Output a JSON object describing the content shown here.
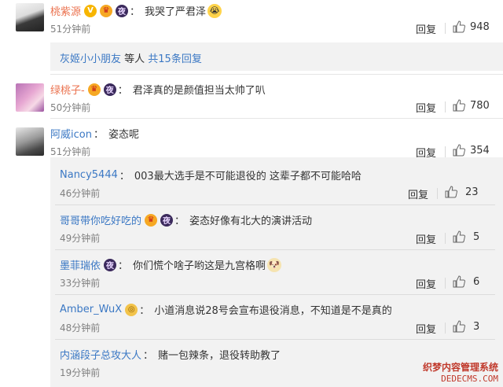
{
  "comments": [
    {
      "user": "桃紫源",
      "text": "我哭了严君泽",
      "time": "51分钟前",
      "reply": "回复",
      "likes": "948",
      "more": {
        "names": "灰姬小小朋友",
        "mid": " 等人 ",
        "count": "共15条回复"
      }
    },
    {
      "user": "绿桃子-",
      "text": "君泽真的是颜值担当太帅了叭",
      "time": "50分钟前",
      "reply": "回复",
      "likes": "780"
    },
    {
      "user": "阿威icon",
      "text": "姿态呢",
      "time": "51分钟前",
      "reply": "回复",
      "likes": "354"
    }
  ],
  "replies": [
    {
      "user": "Nancy5444",
      "text": "003最大选手是不可能退役的 这辈子都不可能哈哈",
      "time": "46分钟前",
      "reply": "回复",
      "likes": "23"
    },
    {
      "user": "哥哥带你吃好吃的",
      "text": "姿态好像有北大的演讲活动",
      "time": "49分钟前",
      "reply": "回复",
      "likes": "5"
    },
    {
      "user": "墨菲瑞依",
      "text": "你们慌个啥子哟这是九宫格啊",
      "time": "33分钟前",
      "reply": "回复",
      "likes": "6"
    },
    {
      "user": "Amber_WuX",
      "text": "小道消息说28号会宣布退役消息，不知道是不是真的",
      "time": "48分钟前",
      "reply": "回复",
      "likes": "3"
    },
    {
      "user": "内涵段子总攻大人",
      "text": "赌一包辣条，退役转助教了",
      "time": "19分钟前"
    }
  ],
  "watermark": {
    "line1": "织梦内容管理系统",
    "line2": "DEDECMS.COM"
  },
  "icons": {
    "like": "thumbs-up-icon",
    "verified": "verified-v-icon",
    "vip": "crown-icon",
    "night": "night-badge-icon"
  }
}
